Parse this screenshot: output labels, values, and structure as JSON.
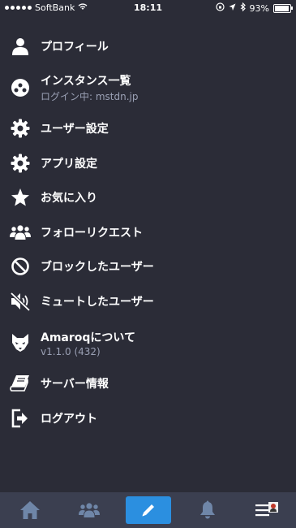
{
  "status_bar": {
    "carrier": "SoftBank",
    "time": "18:11",
    "battery": "93%",
    "battery_level": 0.93
  },
  "menu": {
    "items": [
      {
        "label": "プロフィール",
        "sub": "",
        "icon": "person-icon"
      },
      {
        "label": "インスタンス一覧",
        "sub": "ログイン中: mstdn.jp",
        "icon": "instance-icon"
      },
      {
        "label": "ユーザー設定",
        "sub": "",
        "icon": "gear-icon"
      },
      {
        "label": "アプリ設定",
        "sub": "",
        "icon": "gear-icon"
      },
      {
        "label": "お気に入り",
        "sub": "",
        "icon": "star-icon"
      },
      {
        "label": "フォローリクエスト",
        "sub": "",
        "icon": "group-icon"
      },
      {
        "label": "ブロックしたユーザー",
        "sub": "",
        "icon": "block-icon"
      },
      {
        "label": "ミュートしたユーザー",
        "sub": "",
        "icon": "muted-speaker-icon"
      },
      {
        "label": "Amaroqについて",
        "sub": "v1.1.0 (432)",
        "icon": "wolf-icon"
      },
      {
        "label": "サーバー情報",
        "sub": "",
        "icon": "book-icon"
      },
      {
        "label": "ログアウト",
        "sub": "",
        "icon": "logout-icon"
      }
    ]
  },
  "tab_bar": {
    "tabs": [
      {
        "icon": "home-icon",
        "active": false
      },
      {
        "icon": "group-icon",
        "active": false
      },
      {
        "icon": "compose-icon",
        "active": true
      },
      {
        "icon": "bell-icon",
        "active": false
      },
      {
        "icon": "menu-avatar-icon",
        "active": false
      }
    ]
  },
  "colors": {
    "background": "#2b2c37",
    "tab_bar": "#3b3f50",
    "accent": "#2b8fe0",
    "subtext": "#9aa0b4"
  }
}
